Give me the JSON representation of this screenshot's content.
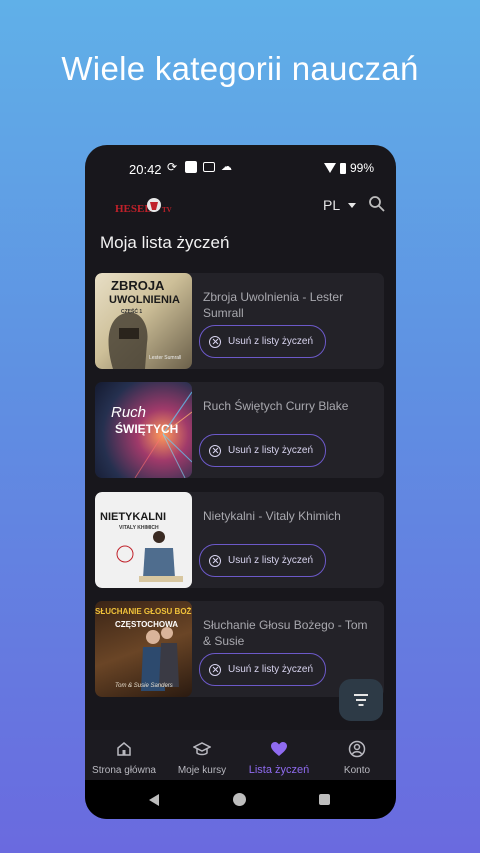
{
  "headline": "Wiele kategorii nauczań",
  "status_bar": {
    "time": "20:42",
    "battery": "99%"
  },
  "app_bar": {
    "logo_text": "HESED",
    "logo_suffix": "TV",
    "language": "PL"
  },
  "page_title": "Moja lista życzeń",
  "remove_label": "Usuń z listy życzeń",
  "items": [
    {
      "title": "Zbroja Uwolnienia - Lester Sumrall",
      "thumb_lines": [
        "ZBROJA",
        "UWOLNIENIA",
        "CZĘŚĆ 1",
        "Lester Sumrall"
      ]
    },
    {
      "title": "Ruch Świętych Curry Blake",
      "thumb_lines": [
        "Ruch",
        "ŚWIĘTYCH"
      ]
    },
    {
      "title": "Nietykalni - Vitaly Khimich",
      "thumb_lines": [
        "NIETYKALNI",
        "VITALY KHIMICH"
      ]
    },
    {
      "title": "Słuchanie Głosu Bożego - Tom & Susie",
      "thumb_lines": [
        "SŁUCHANIE GŁOSU BOŻEGO",
        "CZĘSTOCHOWA",
        "Tom & Susie Sanders"
      ]
    }
  ],
  "bottom_nav": [
    {
      "label": "Strona główna",
      "icon": "home-icon"
    },
    {
      "label": "Moje kursy",
      "icon": "graduation-cap-icon"
    },
    {
      "label": "Lista życzeń",
      "icon": "heart-icon"
    },
    {
      "label": "Konto",
      "icon": "account-icon"
    }
  ],
  "colors": {
    "accent": "#8f6bf0",
    "background": "#18171c",
    "card": "#232228"
  }
}
